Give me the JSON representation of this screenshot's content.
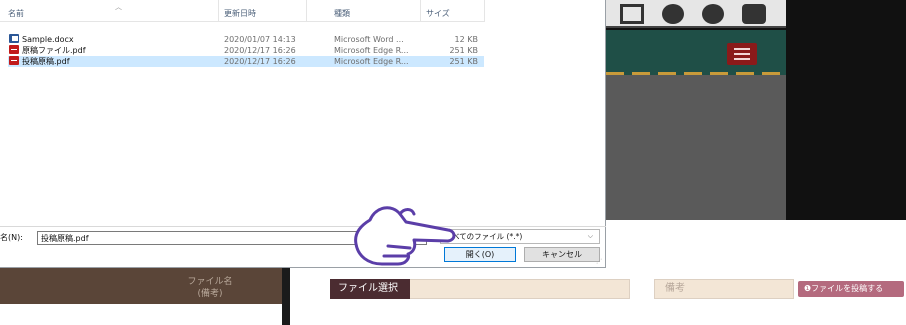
{
  "dialog": {
    "columns": {
      "name": "名前",
      "date": "更新日時",
      "type": "種類",
      "size": "サイズ"
    },
    "files": [
      {
        "icon": "word-doc-icon",
        "name": "Sample.docx",
        "date": "2020/01/07 14:13",
        "type": "Microsoft Word ...",
        "size": "12 KB",
        "selected": false
      },
      {
        "icon": "pdf-icon",
        "name": "原稿ファイル.pdf",
        "date": "2020/12/17 16:26",
        "type": "Microsoft Edge R...",
        "size": "251 KB",
        "selected": false
      },
      {
        "icon": "pdf-icon",
        "name": "投稿原稿.pdf",
        "date": "2020/12/17 16:26",
        "type": "Microsoft Edge R...",
        "size": "251 KB",
        "selected": true
      }
    ],
    "filename_label": "名(N):",
    "filename_value": "投稿原稿.pdf",
    "filetype_value": "すべてのファイル (*.*)",
    "open_button": "開く(O)",
    "cancel_button": "キャンセル"
  },
  "page": {
    "sidebar_column_label_1": "ファイル名",
    "sidebar_column_label_2": "(備考)",
    "file_select_label": "ファイル選択",
    "memo_placeholder": "備考",
    "post_button": "❶ファイルを投稿する"
  },
  "colors": {
    "selection": "#cce8ff",
    "accent_button_border": "#0078d7",
    "app_teal": "#1f4f47",
    "app_menu_red": "#8a1a1a",
    "file_select_label_bg": "#4b2c31",
    "post_button_bg": "#b46a7e"
  },
  "icons": {
    "top_icons": [
      "mail-icon",
      "gear-icon",
      "help-icon",
      "share-icon"
    ],
    "menu": "hamburger-menu-icon",
    "pointer": "pointing-hand-icon"
  }
}
